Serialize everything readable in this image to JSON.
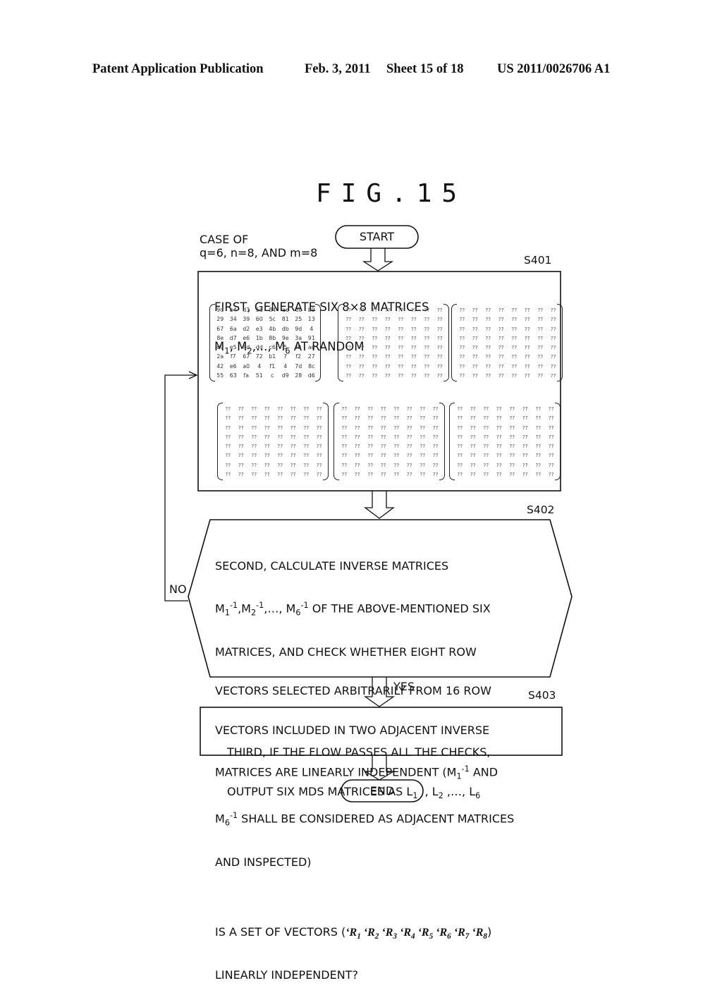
{
  "header": {
    "publication": "Patent Application Publication",
    "date": "Feb. 3, 2011",
    "sheet": "Sheet 15 of 18",
    "patent_number": "US 2011/0026706 A1"
  },
  "figure": {
    "title": "FIG.15",
    "case_note_line1": "CASE OF",
    "case_note_line2": "q=6, n=8, AND m=8"
  },
  "flow": {
    "start": "START",
    "end": "END",
    "steps": [
      {
        "id": "S401",
        "line1": "FIRST, GENERATE SIX 8×8 MATRICES",
        "line2_parts": [
          "M",
          "1",
          ", M",
          "2",
          ",…, M",
          "6",
          " AT RANDOM"
        ]
      },
      {
        "id": "S402",
        "line1": "SECOND, CALCULATE INVERSE MATRICES",
        "line2_prefix": "M",
        "line2_rest": " OF THE ABOVE-MENTIONED SIX",
        "line3": "MATRICES, AND CHECK WHETHER EIGHT ROW",
        "line4": "VECTORS SELECTED ARBITRARILY FROM 16 ROW",
        "line5": "VECTORS INCLUDED IN TWO ADJACENT INVERSE",
        "line6": "MATRICES ARE LINEARLY INDEPENDENT (M",
        "line6_end": " AND",
        "line7": " SHALL BE CONSIDERED AS ADJACENT MATRICES",
        "line8": "AND INSPECTED)",
        "question_prefix": "IS A SET OF VECTORS (",
        "question_vectors": [
          "1",
          "2",
          "3",
          "4",
          "5",
          "6",
          "7",
          "8"
        ],
        "question_suffix": ")",
        "question_line2": "LINEARLY INDEPENDENT?"
      },
      {
        "id": "S403",
        "line1": "THIRD, IF THE FLOW PASSES ALL THE CHECKS,",
        "line2_prefix": "OUTPUT SIX MDS MATRICES AS L",
        "line2_rest": "  , L",
        "line2_rest2": " ,…, L"
      }
    ],
    "branch_yes": "YES",
    "branch_no": "NO"
  },
  "matrices": {
    "m1": [
      [
        "9d",
        "b4",
        "d3",
        "5d",
        "84",
        "ae",
        "ec",
        "b9"
      ],
      [
        "29",
        "34",
        "39",
        "60",
        "5c",
        "81",
        "25",
        "13"
      ],
      [
        "67",
        "6a",
        "d2",
        "e3",
        "4b",
        "db",
        "9d",
        "4"
      ],
      [
        "8e",
        "d7",
        "e6",
        "1b",
        "8b",
        "9e",
        "3a",
        "91"
      ],
      [
        "d9",
        "e5",
        "4d",
        "dd",
        "c6",
        "5",
        "f0",
        "ad"
      ],
      [
        "2a",
        "f7",
        "67",
        "72",
        "b1",
        "7",
        "f2",
        "27"
      ],
      [
        "42",
        "e6",
        "a0",
        "4",
        "f1",
        "4",
        "7d",
        "8c"
      ],
      [
        "55",
        "63",
        "fa",
        "51",
        "c",
        "d9",
        "28",
        "d6"
      ]
    ],
    "unknown_cell": "??",
    "unknown_count": 5
  }
}
